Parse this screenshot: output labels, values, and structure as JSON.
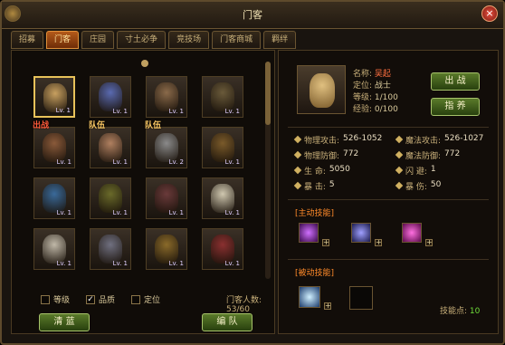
{
  "window": {
    "title": "门客",
    "close": "×"
  },
  "tabs": [
    {
      "label": "招募",
      "active": false
    },
    {
      "label": "门客",
      "active": true
    },
    {
      "label": "庄园",
      "active": false
    },
    {
      "label": "寸土必争",
      "active": false
    },
    {
      "label": "竞技场",
      "active": false
    },
    {
      "label": "门客商城",
      "active": false
    },
    {
      "label": "羁绊",
      "active": false
    }
  ],
  "heroes": [
    {
      "lv": "Lv. 1",
      "selected": true,
      "tag": "",
      "face": "#c8a060"
    },
    {
      "lv": "Lv. 1",
      "selected": false,
      "tag": "",
      "face": "#5a6ab0"
    },
    {
      "lv": "Lv. 1",
      "selected": false,
      "tag": "",
      "face": "#8a6a4a"
    },
    {
      "lv": "Lv. 1",
      "selected": false,
      "tag": "",
      "face": "#6a5a3a"
    },
    {
      "lv": "Lv. 1",
      "selected": false,
      "tag": "出战",
      "face": "#8a5a3a"
    },
    {
      "lv": "Lv. 1",
      "selected": false,
      "tag": "队伍",
      "face": "#b08060"
    },
    {
      "lv": "Lv. 2",
      "selected": false,
      "tag": "队伍",
      "face": "#8a8a8a"
    },
    {
      "lv": "Lv. 1",
      "selected": false,
      "tag": "",
      "face": "#7a5a2a"
    },
    {
      "lv": "Lv. 1",
      "selected": false,
      "tag": "",
      "face": "#3a6a9a"
    },
    {
      "lv": "Lv. 1",
      "selected": false,
      "tag": "",
      "face": "#6a6a2a"
    },
    {
      "lv": "Lv. 1",
      "selected": false,
      "tag": "",
      "face": "#6a3a3a"
    },
    {
      "lv": "Lv. 1",
      "selected": false,
      "tag": "",
      "face": "#d0c8b0"
    },
    {
      "lv": "Lv. 1",
      "selected": false,
      "tag": "",
      "face": "#c0b8a8"
    },
    {
      "lv": "Lv. 1",
      "selected": false,
      "tag": "",
      "face": "#707080"
    },
    {
      "lv": "Lv. 1",
      "selected": false,
      "tag": "",
      "face": "#8a6a2a"
    },
    {
      "lv": "Lv. 1",
      "selected": false,
      "tag": "",
      "face": "#8a3030"
    }
  ],
  "tags_text": {
    "battle": "出战",
    "party": "队伍"
  },
  "filters": {
    "level": "等级",
    "quality": "品质",
    "position": "定位",
    "quality_checked": "✓"
  },
  "count_label": "门客人数: 53/60",
  "buttons": {
    "clear": "清 蓝",
    "formation": "编 队",
    "battle": "出 战",
    "dismiss": "指 养"
  },
  "hero": {
    "name_label": "名称:",
    "name": "吴起",
    "role_label": "定位:",
    "role": "战士",
    "level_label": "等级:",
    "level": "1/100",
    "exp_label": "经验:",
    "exp": "0/100"
  },
  "stats": [
    {
      "k": "物理攻击:",
      "v": "526-1052"
    },
    {
      "k": "魔法攻击:",
      "v": "526-1027"
    },
    {
      "k": "物理防御:",
      "v": "772"
    },
    {
      "k": "魔法防御:",
      "v": "772"
    },
    {
      "k": "生    命:",
      "v": "5050"
    },
    {
      "k": "闪    避:",
      "v": "1"
    },
    {
      "k": "暴    击:",
      "v": "5"
    },
    {
      "k": "暴    伤:",
      "v": "50"
    }
  ],
  "active_skills_title": "[主动技能]",
  "passive_skills_title": "[被动技能]",
  "skill_points_label": "技能点:",
  "skill_points": "10",
  "colors": {
    "accent": "#ff8a2a",
    "green_button": "#4a6a20",
    "highlight": "#e8c25a"
  }
}
